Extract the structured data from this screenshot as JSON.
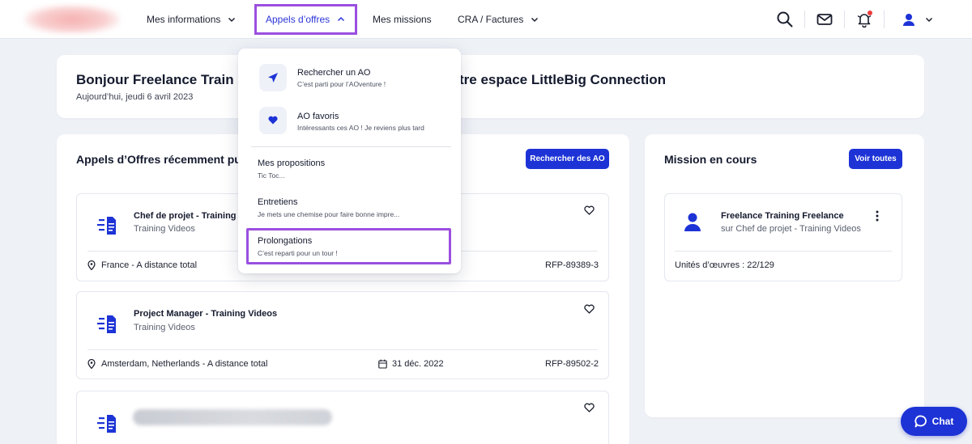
{
  "nav": {
    "items": [
      {
        "label": "Mes informations"
      },
      {
        "label": "Appels d’offres"
      },
      {
        "label": "Mes missions"
      },
      {
        "label": "CRA / Factures"
      }
    ],
    "icons": [
      "search-icon",
      "mail-icon",
      "bell-icon",
      "user-icon"
    ],
    "accent": "#1d33d6",
    "highlight": "#9b4fe0"
  },
  "welcome": {
    "title_left": "Bonjour Freelance Train",
    "title_right": "tre espace LittleBig Connection",
    "date": "Aujourd’hui, jeudi 6 avril 2023"
  },
  "dropdown": {
    "items": [
      {
        "title": "Rechercher un AO",
        "subtitle": "C’est parti pour l’AOventure !",
        "icon": "send-icon"
      },
      {
        "title": "AO favoris",
        "subtitle": "Intéressants ces AO ! Je reviens plus tard",
        "icon": "heart-icon"
      },
      {
        "title": "Mes propositions",
        "subtitle": "Tic Toc..."
      },
      {
        "title": "Entretiens",
        "subtitle": "Je mets une chemise pour faire bonne impre..."
      },
      {
        "title": "Prolongations",
        "subtitle": "C’est reparti pour un tour !"
      }
    ]
  },
  "ao_section": {
    "title": "Appels d’Offres récemment pu",
    "button": "Rechercher des AO",
    "cards": [
      {
        "title": "Chef de projet - Training",
        "company": "Training Videos",
        "location": "France - A distance total",
        "date": "",
        "ref": "RFP-89389-3"
      },
      {
        "title": "Project Manager - Training Videos",
        "company": "Training Videos",
        "location": "Amsterdam, Netherlands - A distance total",
        "date": "31 déc. 2022",
        "ref": "RFP-89502-2"
      }
    ]
  },
  "mission_section": {
    "title": "Mission en cours",
    "button": "Voir toutes",
    "card": {
      "name": "Freelance Training Freelance",
      "subtitle": "sur Chef de projet - Training Videos",
      "units": "Unités d’œuvres : 22/129"
    }
  },
  "chat": {
    "label": "Chat"
  }
}
